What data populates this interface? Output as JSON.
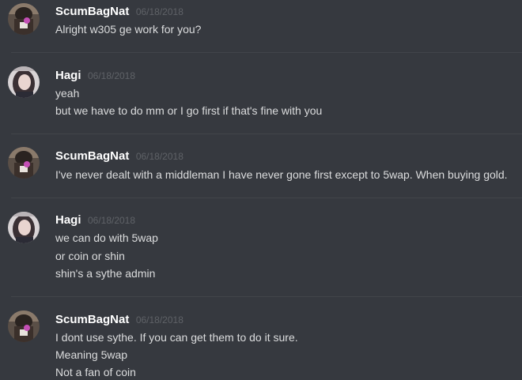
{
  "messages": [
    {
      "author": "ScumBagNat",
      "timestamp": "06/18/2018",
      "avatar": "scumbagnat-avatar",
      "lines": [
        "Alright w305 ge work for you?"
      ]
    },
    {
      "author": "Hagi",
      "timestamp": "06/18/2018",
      "avatar": "hagi-avatar",
      "lines": [
        "yeah",
        "but we have to do mm or I go first if that's fine with you"
      ]
    },
    {
      "author": "ScumBagNat",
      "timestamp": "06/18/2018",
      "avatar": "scumbagnat-avatar",
      "lines": [
        "I've never dealt with a middleman I have never gone first except to 5wap. When buying gold."
      ]
    },
    {
      "author": "Hagi",
      "timestamp": "06/18/2018",
      "avatar": "hagi-avatar",
      "lines": [
        "we can do with 5wap",
        "or coin or shin",
        "shin's a sythe admin"
      ]
    },
    {
      "author": "ScumBagNat",
      "timestamp": "06/18/2018",
      "avatar": "scumbagnat-avatar",
      "lines": [
        "I dont use sythe. If you can get them to do it sure.",
        "Meaning 5wap",
        "Not a fan of coin"
      ]
    }
  ],
  "colors": {
    "background": "#36393f",
    "divider": "#42454a",
    "username": "#ffffff",
    "timestamp": "#5f6267",
    "text": "#dcddde"
  }
}
